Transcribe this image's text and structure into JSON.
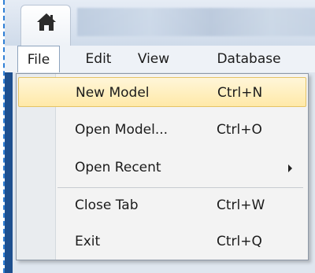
{
  "menubar": {
    "file": "File",
    "edit": "Edit",
    "view": "View",
    "database": "Database",
    "partial": ""
  },
  "file_menu": {
    "items": [
      {
        "label": "New Model",
        "shortcut": "Ctrl+N",
        "highlighted": true
      },
      {
        "label": "Open Model...",
        "shortcut": "Ctrl+O"
      },
      {
        "label": "Open Recent",
        "shortcut": "",
        "submenu": true
      },
      {
        "label": "Close Tab",
        "shortcut": "Ctrl+W"
      },
      {
        "label": "Exit",
        "shortcut": "Ctrl+Q"
      }
    ]
  },
  "icons": {
    "home": "home-icon",
    "submenu_arrow": "chevron-right-icon"
  },
  "colors": {
    "highlight": "#ffe9a8",
    "highlight_border": "#e5c365",
    "menu_background": "#f3f3f3",
    "ribbon_background": "#cfdbea"
  }
}
